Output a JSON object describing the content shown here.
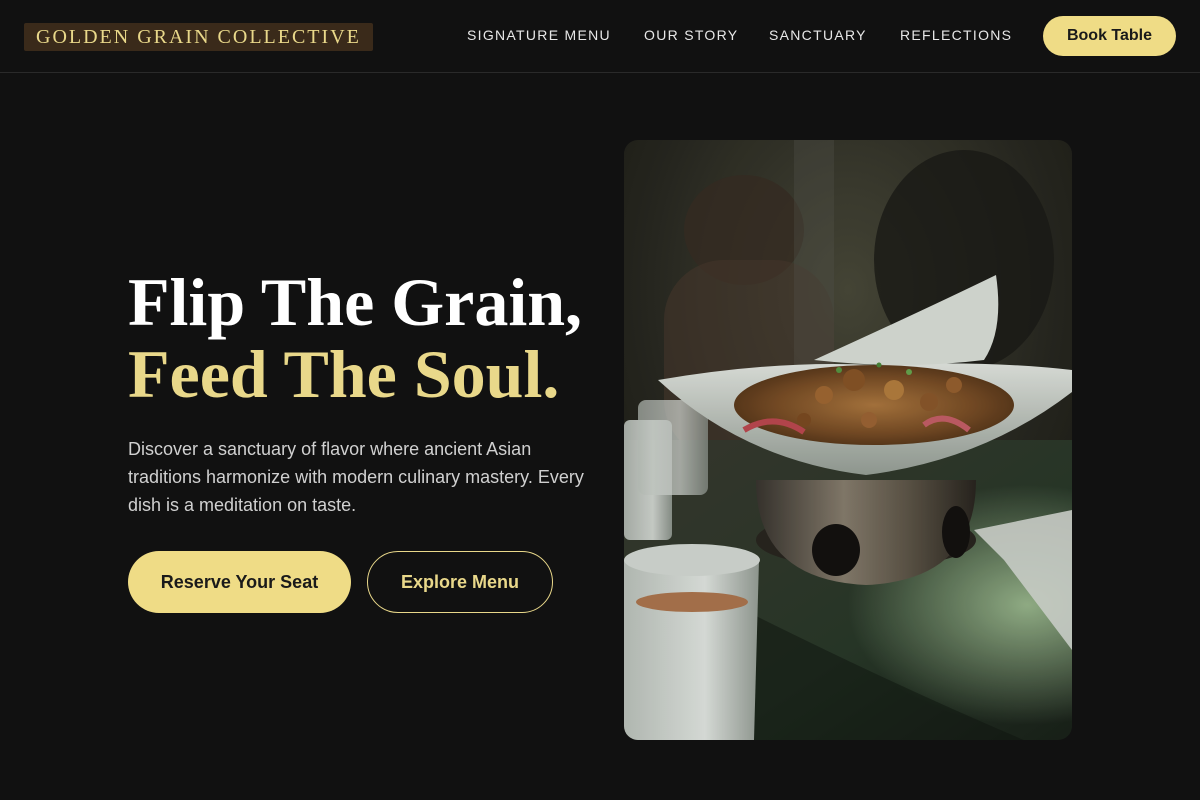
{
  "header": {
    "logo": "GOLDEN GRAIN COLLECTIVE",
    "nav": [
      "SIGNATURE MENU",
      "OUR STORY",
      "SANCTUARY",
      "REFLECTIONS"
    ],
    "cta_label": "Book Table"
  },
  "hero": {
    "title_line1": "Flip The Grain,",
    "title_line2": "Feed The Soul.",
    "description": "Discover a sanctuary of flavor where ancient Asian traditions harmonize with modern culinary mastery. Every dish is a meditation on taste.",
    "primary_button": "Reserve Your Seat",
    "secondary_button": "Explore Menu",
    "image_alt": "Stir-fried dish served in a white bowl on a metal warmer"
  },
  "colors": {
    "background": "#111111",
    "accent": "#efdc86",
    "accent_text": "#e9d88a"
  }
}
